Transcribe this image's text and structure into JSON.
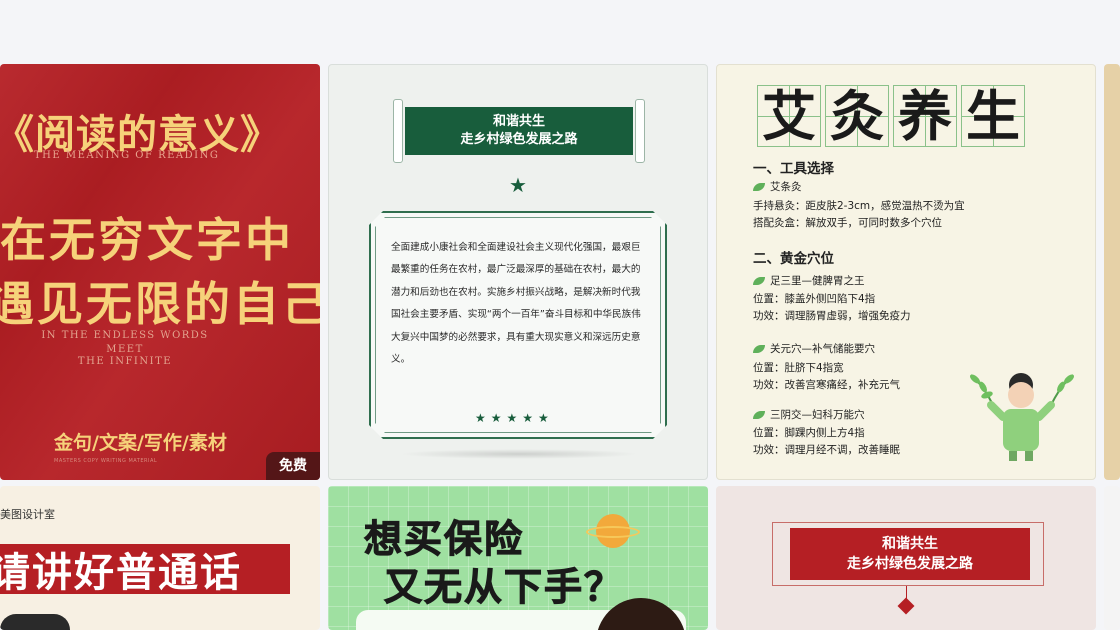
{
  "cards": {
    "reading": {
      "title": "《阅读的意义》",
      "subtitle_en": "THE MEANING OF READING",
      "line1": "在无穷文字中",
      "line2": "遇见无限的自己",
      "en1": "IN THE ENDLESS WORDS",
      "en2": "MEET",
      "en3": "THE INFINITE",
      "categories": "金句/文案/写作/素材",
      "small": "MASTERS COPY WRITING MATERIAL",
      "badge": "免费"
    },
    "rural": {
      "banner_line1": "和谐共生",
      "banner_line2": "走乡村绿色发展之路",
      "paragraph": "全面建成小康社会和全面建设社会主义现代化强国，最艰巨最繁重的任务在农村，最广泛最深厚的基础在农村，最大的潜力和后劲也在农村。实施乡村振兴战略，是解决新时代我国社会主要矛盾、实现“两个一百年”奋斗目标和中华民族伟大复兴中国梦的必然要求，具有重大现实意义和深远历史意义。",
      "stars": "★★★★★",
      "star_top": "★"
    },
    "moxibustion": {
      "chars": [
        "艾",
        "灸",
        "养",
        "生"
      ],
      "h1": "一、工具选择",
      "item1": "艾条灸",
      "item1_a": "手持悬灸：距皮肤2-3cm，感觉温热不烫为宜",
      "item1_b": "搭配灸盒：解放双手，可同时数多个穴位",
      "h2": "二、黄金穴位",
      "p1": "足三里—健脾胃之王",
      "p1_a": "位置：膝盖外侧凹陷下4指",
      "p1_b": "功效：调理肠胃虚弱，增强免疫力",
      "p2": "关元穴—补气储能要穴",
      "p2_a": "位置：肚脐下4指宽",
      "p2_b": "功效：改善宫寒痛经，补充元气",
      "p3": "三阴交—妇科万能穴",
      "p3_a": "位置：脚踝内侧上方4指",
      "p3_b": "功效：调理月经不调，改善睡眠"
    },
    "mandarin": {
      "brand": "美图设计室",
      "title": "请讲好普通话"
    },
    "insurance": {
      "line1": "想买保险",
      "line2": "又无从下手？"
    },
    "rural2": {
      "banner_line1": "和谐共生",
      "banner_line2": "走乡村绿色发展之路"
    }
  }
}
